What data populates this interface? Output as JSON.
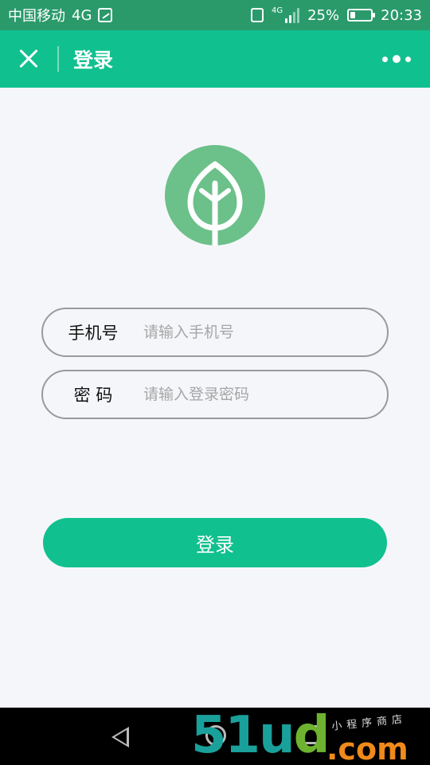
{
  "status_bar": {
    "carrier": "中国移动",
    "network": "4G",
    "signal_network": "4G",
    "battery_percent": "25%",
    "battery_level": 0.25,
    "time": "20:33"
  },
  "nav": {
    "title": "登录",
    "close_icon": "close-icon",
    "more_icon": "more-dots-icon"
  },
  "logo": {
    "icon": "leaf-icon",
    "color": "#6cc08a"
  },
  "form": {
    "phone_label": "手机号",
    "phone_placeholder": "请输入手机号",
    "phone_value": "",
    "password_label": "密 码",
    "password_placeholder": "请输入登录密码",
    "password_value": ""
  },
  "login_button": {
    "label": "登录",
    "color": "#11c08f"
  },
  "watermark": {
    "main": "51u",
    "accent": "d",
    "domain": ".com",
    "tagline": "小程序商店"
  },
  "colors": {
    "status_bar": "#2a9a6a",
    "accent": "#11c08f",
    "background": "#f5f6fa"
  }
}
